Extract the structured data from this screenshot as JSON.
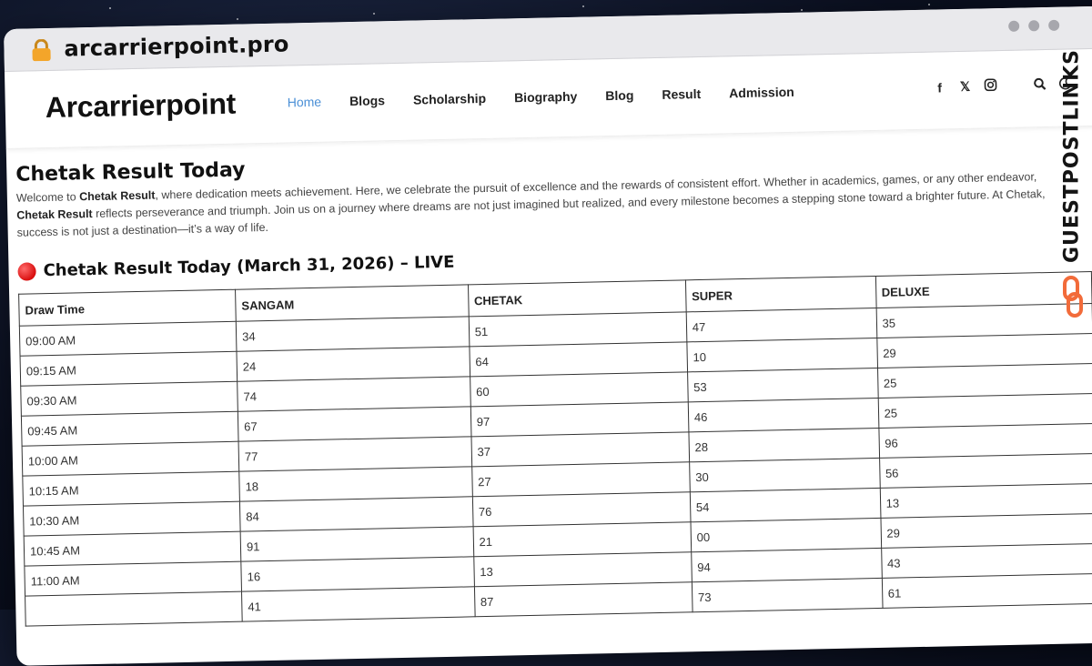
{
  "browser": {
    "url": "arcarrierpoint.pro"
  },
  "site": {
    "logo": "Arcarrierpoint",
    "nav": [
      "Home",
      "Blogs",
      "Scholarship",
      "Biography",
      "Blog",
      "Result",
      "Admission"
    ],
    "active_nav": "Home",
    "social_icons": [
      "facebook-icon",
      "x-icon",
      "instagram-icon"
    ],
    "tool_icons": [
      "search-icon",
      "moon-icon"
    ]
  },
  "page": {
    "title": "Chetak Result Today",
    "intro": {
      "p1": "Welcome to ",
      "b1": "Chetak Result",
      "p2": ", where dedication meets achievement. Here, we celebrate the pursuit of excellence and the rewards of consistent effort. Whether in academics, games, or any other endeavor, ",
      "b2": "Chetak Result",
      "p3": " reflects perseverance and triumph. Join us on a journey where dreams are not just imagined but realized, and every milestone becomes a stepping stone toward a brighter future. At Chetak, success is not just a destination—it’s a way of life."
    },
    "live_heading": "Chetak Result Today (March 31, 2026) – LIVE"
  },
  "table": {
    "headers": [
      "Draw Time",
      "SANGAM",
      "CHETAK",
      "SUPER",
      "DELUXE"
    ],
    "rows": [
      [
        "09:00 AM",
        "34",
        "51",
        "47",
        "35"
      ],
      [
        "09:15 AM",
        "24",
        "64",
        "10",
        "29"
      ],
      [
        "09:30 AM",
        "74",
        "60",
        "53",
        "25"
      ],
      [
        "09:45 AM",
        "67",
        "97",
        "46",
        "25"
      ],
      [
        "10:00 AM",
        "77",
        "37",
        "28",
        "96"
      ],
      [
        "10:15 AM",
        "18",
        "27",
        "30",
        "56"
      ],
      [
        "10:30 AM",
        "84",
        "76",
        "54",
        "13"
      ],
      [
        "10:45 AM",
        "91",
        "21",
        "00",
        "29"
      ],
      [
        "11:00 AM",
        "16",
        "13",
        "94",
        "43"
      ],
      [
        "",
        "41",
        "87",
        "73",
        "61"
      ]
    ]
  },
  "watermark": {
    "text": "GUESTPOSTLINKS",
    "accent": "#f26b3a"
  },
  "colors": {
    "nav_active": "#4a8fd6",
    "live_dot": "#d90f0f"
  }
}
